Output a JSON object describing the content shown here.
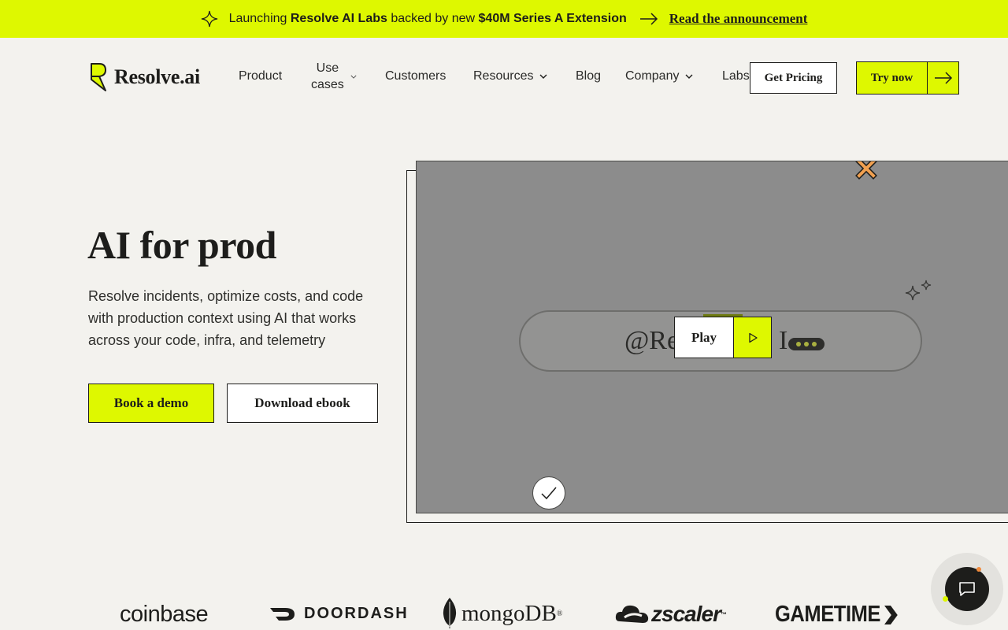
{
  "announcement": {
    "prefix": "Launching ",
    "bold1": "Resolve AI Labs",
    "middle": " backed by new ",
    "bold2": "$40M Series A Extension",
    "link": "Read the announcement"
  },
  "nav": {
    "brand": "Resolve.ai",
    "items": [
      {
        "label": "Product"
      },
      {
        "label_line1": "Use",
        "label_line2": "cases"
      },
      {
        "label": "Customers"
      },
      {
        "label": "Resources"
      },
      {
        "label": "Blog"
      },
      {
        "label": "Company"
      },
      {
        "label": "Labs"
      }
    ],
    "pricing_label": "Get Pricing",
    "try_label": "Try now"
  },
  "hero": {
    "title": "AI for prod",
    "subtitle": "Resolve incidents, optimize costs, and code with production context using AI that works across your code, infra, and telemetry",
    "primary_cta": "Book a demo",
    "secondary_cta": "Download ebook"
  },
  "video": {
    "pill_text_left": "@Re",
    "pill_text_right": "I",
    "play_label": "Play"
  },
  "logos": {
    "coinbase": "coinbase",
    "doordash": "DOORDASH",
    "mongodb": "mongoDB",
    "mongodb_mark": "®",
    "zscaler": "zscaler",
    "zscaler_mark": "™",
    "gametime": "GAMETIME"
  },
  "colors": {
    "accent": "#def800",
    "background": "#f3f2ee",
    "ink": "#1d1d1b"
  }
}
